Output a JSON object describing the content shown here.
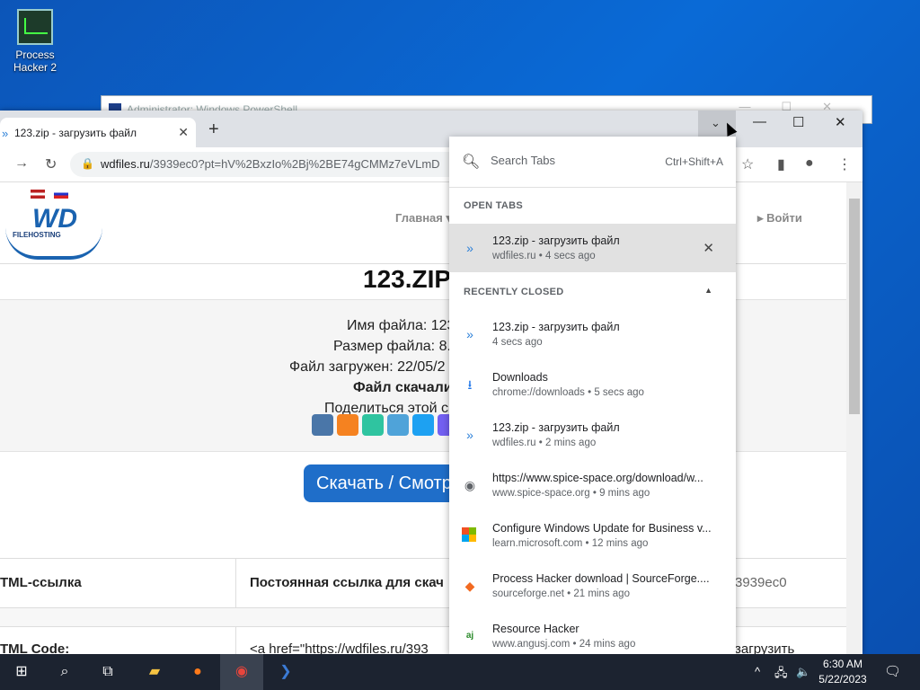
{
  "desktop": {
    "icon_label": "Process Hacker 2"
  },
  "powershell": {
    "title": "Administrator: Windows PowerShell"
  },
  "browser": {
    "tab_title": "123.zip - загрузить файл",
    "url_host": "wdfiles.ru",
    "url_rest": "/3939ec0?pt=hV%2BxzIo%2Bj%2BE74gCMMz7eVLmD"
  },
  "site": {
    "logo_text": "WD",
    "logo_sub": "FILEHOSTING",
    "nav_main": "Главная ▾",
    "nav_login": "▸ Войти",
    "heading": "123.ZIP",
    "info": [
      "Имя файла: 123",
      "Размер файла: 8.",
      "Файл загружен: 22/05/2",
      "Файл скачали",
      "Поделиться этой с"
    ],
    "download_button": "Скачать / Смотр",
    "table_col1": "TML-ссылка",
    "table_col2": "Постоянная ссылка для скач",
    "table_right1": "3939ec0",
    "table_row2_col1": "TML Code:",
    "table_row2_col2": "<a href=\"https://wdfiles.ru/393",
    "table_row2_right": "загрузить"
  },
  "tab_search": {
    "placeholder": "Search Tabs",
    "shortcut": "Ctrl+Shift+A",
    "open_tabs_header": "OPEN TABS",
    "recently_closed_header": "RECENTLY CLOSED",
    "open_tabs": [
      {
        "title": "123.zip - загрузить файл",
        "sub": "wdfiles.ru • 4 secs ago"
      }
    ],
    "recent": [
      {
        "title": "123.zip - загрузить файл",
        "sub": "4 secs ago",
        "icon": "wdfiles-icon"
      },
      {
        "title": "Downloads",
        "sub": "chrome://downloads • 5 secs ago",
        "icon": "download-icon"
      },
      {
        "title": "123.zip - загрузить файл",
        "sub": "wdfiles.ru • 2 mins ago",
        "icon": "wdfiles-icon"
      },
      {
        "title": "https://www.spice-space.org/download/w...",
        "sub": "www.spice-space.org • 9 mins ago",
        "icon": "globe-icon"
      },
      {
        "title": "Configure Windows Update for Business v...",
        "sub": "learn.microsoft.com • 12 mins ago",
        "icon": "microsoft-icon"
      },
      {
        "title": "Process Hacker download | SourceForge....",
        "sub": "sourceforge.net • 21 mins ago",
        "icon": "sourceforge-icon"
      },
      {
        "title": "Resource Hacker",
        "sub": "www.angusj.com • 24 mins ago",
        "icon": "angusj-icon"
      }
    ]
  },
  "taskbar": {
    "time": "6:30 AM",
    "date": "5/22/2023"
  },
  "colors": {
    "accent": "#1f6ec9",
    "taskbar": "#1c2330",
    "desktop": "#0a63c9"
  }
}
